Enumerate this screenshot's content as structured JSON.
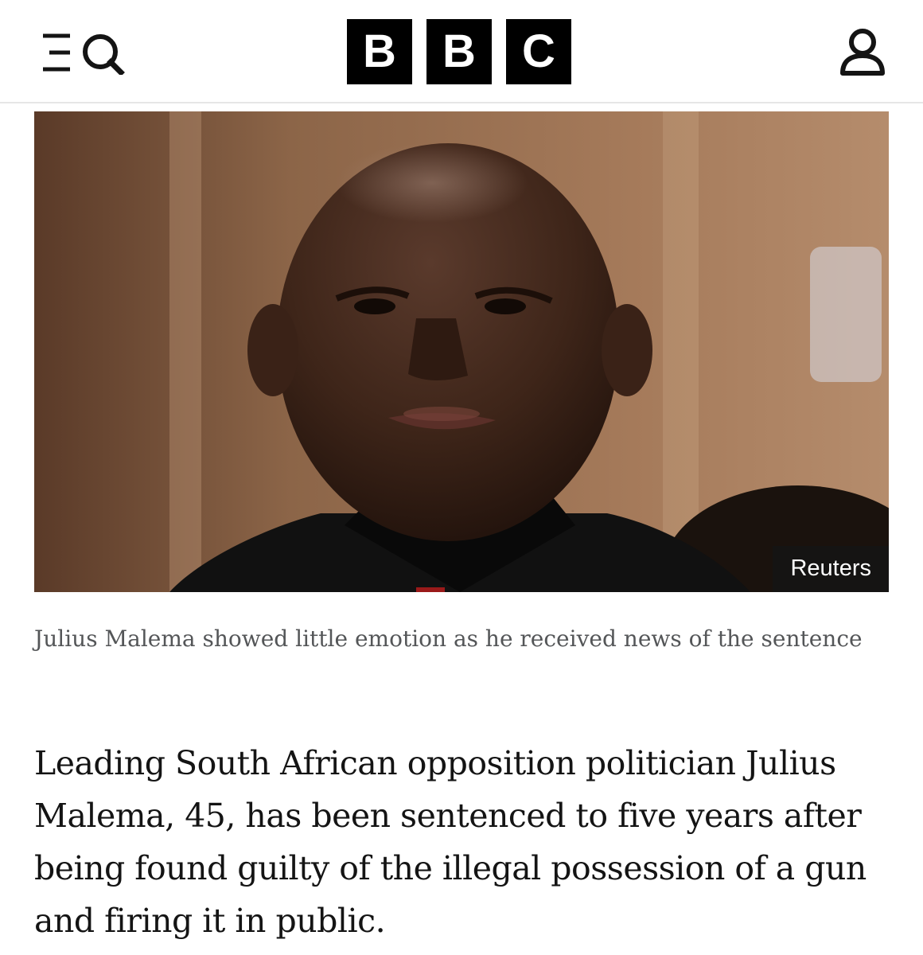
{
  "header": {
    "brand_letters": [
      "B",
      "B",
      "C"
    ],
    "menu_icon": "menu-icon",
    "search_icon": "search-icon",
    "account_icon": "account-icon"
  },
  "article": {
    "image": {
      "credit": "Reuters",
      "alt": "Julius Malema"
    },
    "caption": "Julius Malema showed little emotion as he received news of the sentence",
    "lead": "Leading South African opposition politician Julius Malema, 45, has been sentenced to five years after being found guilty of the illegal possession of a gun and firing it in public."
  },
  "colors": {
    "brand_block": "#000000",
    "caption_text": "#545658",
    "body_text": "#141414",
    "divider": "#e6e6e6"
  }
}
